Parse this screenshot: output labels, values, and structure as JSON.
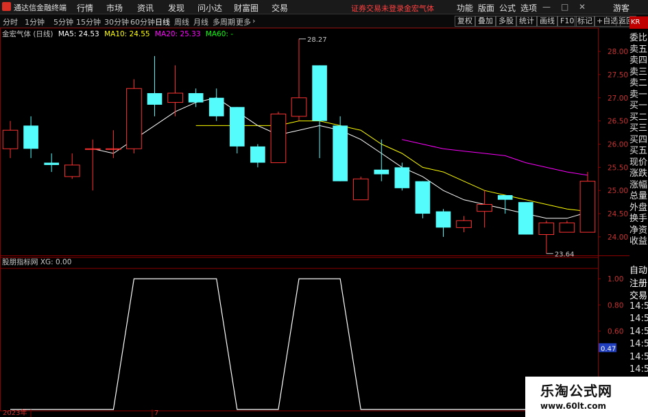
{
  "app": {
    "title": "通达信金融终端"
  },
  "menu": [
    "行情",
    "市场",
    "资讯",
    "发现",
    "问小达",
    "财富圈",
    "交易"
  ],
  "warning": "证券交易未登录",
  "stock_name": "金宏气体",
  "right_menu": [
    "功能",
    "版面",
    "公式",
    "选项"
  ],
  "guest": "游客",
  "timeframes": [
    "分时",
    "1分钟",
    "5分钟",
    "15分钟",
    "30分钟",
    "60分钟",
    "日线",
    "周线",
    "月线",
    "多周期",
    "更多"
  ],
  "active_timeframe": "日线",
  "tool_buttons": [
    "复权",
    "叠加",
    "多股",
    "统计",
    "画线",
    "F10",
    "标记",
    "+自选",
    "返回"
  ],
  "legend": {
    "title": "金宏气体 (日线)",
    "ma5": "MA5: 24.53",
    "ma10": "MA10: 24.55",
    "ma20": "MA20: 25.33",
    "ma60": "MA60: -"
  },
  "sub_legend": "股朋指标网 XG: 0.00",
  "side_panel": [
    "委比",
    "卖五",
    "卖四",
    "卖三",
    "卖二",
    "卖一",
    "买一",
    "买二",
    "买三",
    "买四",
    "买五",
    "现价",
    "涨跌",
    "涨幅",
    "总量",
    "外盘",
    "换手",
    "净资",
    "收益"
  ],
  "side_panel2": [
    "自动",
    "注册",
    "交易",
    "14:56",
    "14:56",
    "14:56",
    "14:56",
    "14:56",
    "14:56",
    "14:56"
  ],
  "side_badge": "KR",
  "x_labels": [
    "2023年",
    "7"
  ],
  "watermark": {
    "title": "乐淘公式网",
    "url": "www.60lt.com"
  },
  "colors": {
    "up": "#ff3232",
    "down": "#54fcfc",
    "ma5": "#ffffff",
    "ma10": "#ffff00",
    "ma20": "#ff00ff",
    "grid": "#8b0000"
  },
  "chart_data": [
    {
      "type": "candlestick",
      "title": "金宏气体 (日线)",
      "ylim": [
        23.6,
        28.4
      ],
      "yticks": [
        24.0,
        24.5,
        25.0,
        25.5,
        26.0,
        26.5,
        27.0,
        27.5,
        28.0
      ],
      "candles": [
        [
          25.9,
          26.3,
          25.7,
          26.5
        ],
        [
          26.4,
          25.9,
          25.7,
          26.6
        ],
        [
          25.6,
          25.55,
          25.4,
          25.8
        ],
        [
          25.3,
          25.55,
          25.25,
          25.8
        ],
        [
          25.9,
          25.9,
          25.0,
          26.1
        ],
        [
          25.9,
          25.9,
          25.7,
          26.3
        ],
        [
          25.9,
          27.2,
          25.8,
          27.4
        ],
        [
          27.1,
          26.85,
          26.6,
          27.9
        ],
        [
          26.9,
          27.1,
          26.6,
          27.7
        ],
        [
          27.1,
          26.9,
          26.8,
          27.2
        ],
        [
          27.0,
          26.6,
          26.5,
          27.2
        ],
        [
          26.8,
          25.95,
          25.8,
          26.8
        ],
        [
          25.95,
          25.6,
          25.5,
          26.0
        ],
        [
          25.6,
          26.65,
          25.6,
          26.7
        ],
        [
          26.6,
          27.0,
          26.5,
          28.27
        ],
        [
          27.7,
          26.5,
          25.7,
          27.7
        ],
        [
          26.4,
          25.2,
          25.2,
          26.6
        ],
        [
          24.8,
          25.25,
          24.8,
          25.3
        ],
        [
          25.45,
          25.35,
          25.2,
          26.1
        ],
        [
          25.5,
          25.05,
          25.0,
          25.6
        ],
        [
          25.2,
          24.5,
          24.4,
          25.2
        ],
        [
          24.55,
          24.2,
          24.0,
          24.6
        ],
        [
          24.2,
          24.35,
          24.1,
          24.45
        ],
        [
          24.55,
          24.7,
          24.2,
          25.0
        ],
        [
          24.9,
          24.8,
          24.5,
          24.9
        ],
        [
          24.75,
          24.05,
          24.05,
          24.75
        ],
        [
          24.05,
          24.3,
          23.64,
          24.35
        ],
        [
          24.1,
          24.3,
          24.1,
          24.35
        ],
        [
          24.1,
          25.2,
          24.1,
          25.4
        ]
      ],
      "ma5": [
        null,
        null,
        null,
        null,
        25.9,
        25.8,
        26.1,
        26.4,
        26.7,
        26.9,
        27.0,
        26.7,
        26.4,
        26.2,
        26.3,
        26.4,
        26.3,
        26.1,
        25.8,
        25.5,
        25.3,
        25.0,
        24.8,
        24.7,
        24.6,
        24.5,
        24.4,
        24.4,
        24.53
      ],
      "ma10": [
        null,
        null,
        null,
        null,
        null,
        null,
        null,
        null,
        null,
        26.4,
        26.4,
        26.4,
        26.4,
        26.4,
        26.5,
        26.5,
        26.4,
        26.3,
        26.0,
        25.8,
        25.5,
        25.4,
        25.2,
        25.0,
        24.9,
        24.8,
        24.7,
        24.6,
        24.55
      ],
      "ma20": [
        null,
        null,
        null,
        null,
        null,
        null,
        null,
        null,
        null,
        null,
        null,
        null,
        null,
        null,
        null,
        null,
        null,
        null,
        null,
        26.1,
        26.0,
        25.9,
        25.85,
        25.8,
        25.75,
        25.6,
        25.5,
        25.4,
        25.33
      ],
      "ma60": [],
      "annotations": [
        {
          "label": "28.27",
          "value": 28.27
        },
        {
          "label": "23.64",
          "value": 23.64
        }
      ]
    },
    {
      "type": "line",
      "title": "股朋指标网",
      "series": [
        {
          "name": "XG",
          "values": [
            0,
            0,
            0,
            0,
            0,
            0,
            1,
            1,
            1,
            1,
            1,
            0,
            0,
            0,
            1,
            1,
            1,
            0,
            0,
            0,
            0,
            0,
            0,
            0,
            0,
            0,
            0,
            0,
            0
          ]
        }
      ],
      "ylim": [
        0,
        1.1
      ],
      "yticks": [
        1.0,
        0.8,
        0.6,
        0.47
      ],
      "highlight_tick": "0.47"
    }
  ]
}
